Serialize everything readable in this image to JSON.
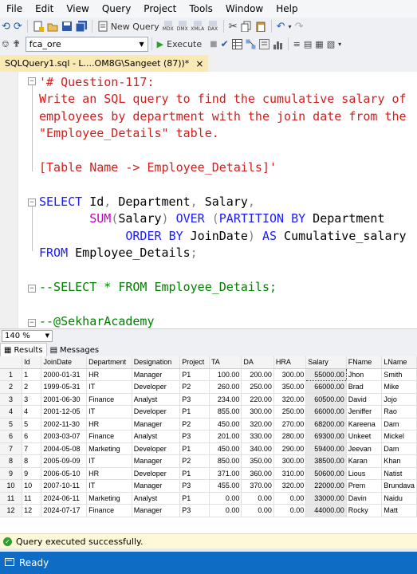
{
  "menu": [
    "File",
    "Edit",
    "View",
    "Query",
    "Project",
    "Tools",
    "Window",
    "Help"
  ],
  "toolbar": {
    "new_query_label": "New Query",
    "database": "fca_ore",
    "execute_label": "Execute",
    "toolbar_icon_labels": [
      "MDX",
      "DMX",
      "XMLA",
      "DAX"
    ]
  },
  "tab": {
    "title": "SQLQuery1.sql - L....OM8G\\Sangeet (87))*",
    "close": "×"
  },
  "editor": {
    "lines": [
      {
        "text": "'# Question-117:",
        "style": "str"
      },
      {
        "text": "Write an SQL query to find the cumulative salary of",
        "style": "str"
      },
      {
        "text": "employees by department with the join date from the",
        "style": "str"
      },
      {
        "text": "\"Employee_Details\" table.",
        "style": "str"
      },
      {
        "text": "",
        "style": "str"
      },
      {
        "text": "[Table Name -> Employee_Details]'",
        "style": "str"
      },
      {
        "text": "",
        "style": "str"
      },
      {
        "text": "",
        "style": "str"
      },
      {
        "text": "SELECT Id, Department, Salary,",
        "style": "sql"
      },
      {
        "text": "       SUM(Salary) OVER (PARTITION BY Department",
        "style": "sql"
      },
      {
        "text": "            ORDER BY JoinDate) AS Cumulative_salary",
        "style": "sql"
      },
      {
        "text": "FROM Employee_Details;",
        "style": "sql"
      },
      {
        "text": "",
        "style": "str"
      },
      {
        "text": "--SELECT * FROM Employee_Details;",
        "style": "cm"
      },
      {
        "text": "",
        "style": "str"
      },
      {
        "text": "--@SekharAcademy",
        "style": "cm"
      }
    ]
  },
  "zoom": "140 %",
  "results_tabs": [
    "Results",
    "Messages"
  ],
  "grid": {
    "columns": [
      "Id",
      "JoinDate",
      "Department",
      "Designation",
      "Project",
      "TA",
      "DA",
      "HRA",
      "Salary",
      "FName",
      "LName"
    ],
    "rows": [
      [
        "1",
        "2000-01-31",
        "HR",
        "Manager",
        "P1",
        "100.00",
        "200.00",
        "300.00",
        "55000.00",
        "Jhon",
        "Smith"
      ],
      [
        "2",
        "1999-05-31",
        "IT",
        "Developer",
        "P2",
        "260.00",
        "250.00",
        "350.00",
        "66000.00",
        "Brad",
        "Mike"
      ],
      [
        "3",
        "2001-06-30",
        "Finance",
        "Analyst",
        "P3",
        "234.00",
        "220.00",
        "320.00",
        "60500.00",
        "David",
        "Jojo"
      ],
      [
        "4",
        "2001-12-05",
        "IT",
        "Developer",
        "P1",
        "855.00",
        "300.00",
        "250.00",
        "66000.00",
        "Jeniffer",
        "Rao"
      ],
      [
        "5",
        "2002-11-30",
        "HR",
        "Manager",
        "P2",
        "450.00",
        "320.00",
        "270.00",
        "68200.00",
        "Kareena",
        "Dam"
      ],
      [
        "6",
        "2003-03-07",
        "Finance",
        "Analyst",
        "P3",
        "201.00",
        "330.00",
        "280.00",
        "69300.00",
        "Unkeet",
        "Mickel"
      ],
      [
        "7",
        "2004-05-08",
        "Marketing",
        "Developer",
        "P1",
        "450.00",
        "340.00",
        "290.00",
        "59400.00",
        "Jeevan",
        "Dam"
      ],
      [
        "8",
        "2005-09-09",
        "IT",
        "Manager",
        "P2",
        "850.00",
        "350.00",
        "300.00",
        "38500.00",
        "Karan",
        "Khan"
      ],
      [
        "9",
        "2006-05-10",
        "HR",
        "Developer",
        "P1",
        "371.00",
        "360.00",
        "310.00",
        "50600.00",
        "Lious",
        "Natist"
      ],
      [
        "10",
        "2007-10-11",
        "IT",
        "Manager",
        "P3",
        "455.00",
        "370.00",
        "320.00",
        "22000.00",
        "Prem",
        "Brundava"
      ],
      [
        "11",
        "2024-06-11",
        "Marketing",
        "Analyst",
        "P1",
        "0.00",
        "0.00",
        "0.00",
        "33000.00",
        "Davin",
        "Naidu"
      ],
      [
        "12",
        "2024-07-17",
        "Finance",
        "Manager",
        "P3",
        "0.00",
        "0.00",
        "0.00",
        "44000.00",
        "Rocky",
        "Matt"
      ]
    ]
  },
  "status_message": "Query executed successfully.",
  "status_bar": "Ready",
  "colors": {
    "string": "#d21e1e",
    "keyword": "#1a1aff",
    "function": "#c000c0",
    "comment": "#008000",
    "statusbar": "#0e6cc4"
  }
}
